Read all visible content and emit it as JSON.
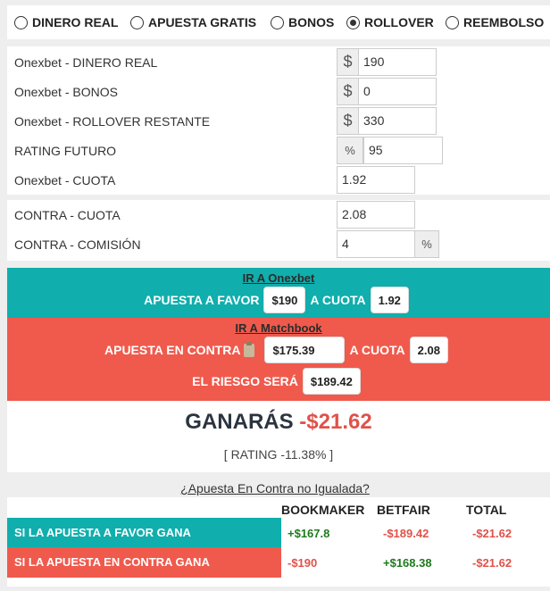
{
  "modes": [
    {
      "label": "DINERO REAL",
      "checked": false
    },
    {
      "label": "APUESTA GRATIS",
      "checked": false
    },
    {
      "label": "BONOS",
      "checked": false
    },
    {
      "label": "ROLLOVER",
      "checked": true
    },
    {
      "label": "REEMBOLSO",
      "checked": false
    }
  ],
  "bookmaker_fields": [
    {
      "label": "Onexbet - DINERO REAL",
      "addon": "$",
      "value": "190"
    },
    {
      "label": "Onexbet - BONOS",
      "addon": "$",
      "value": "0"
    },
    {
      "label": "Onexbet - ROLLOVER RESTANTE",
      "addon": "$",
      "value": "330"
    },
    {
      "label": "RATING FUTURO",
      "addon": "%",
      "value": "95"
    },
    {
      "label": "Onexbet - CUOTA",
      "addon": "",
      "value": "1.92"
    }
  ],
  "contra_fields": [
    {
      "label": "CONTRA - CUOTA",
      "value": "2.08"
    },
    {
      "label": "CONTRA - COMISIÓN",
      "value": "4",
      "addon": "%"
    }
  ],
  "favor_band": {
    "link": "IR A Onexbet",
    "stake_label": "APUESTA A FAVOR",
    "stake": "$190",
    "odds_label": "A CUOTA",
    "odds": "1.92",
    "color": "#10aeac"
  },
  "contra_band": {
    "link": "IR A Matchbook",
    "stake_label": "APUESTA EN CONTRA",
    "stake": "$175.39",
    "odds_label": "A CUOTA",
    "odds": "2.08",
    "risk_label": "EL RIESGO SERÁ",
    "risk": "$189.42",
    "color": "#ef5a4d"
  },
  "result": {
    "label": "GANARÁS",
    "value": "-$21.62",
    "rating": "[ RATING -11.38% ]"
  },
  "unmatched_link": "¿Apuesta En Contra no Igualada?",
  "table": {
    "headers": [
      "BOOKMAKER",
      "BETFAIR",
      "TOTAL"
    ],
    "rows": [
      {
        "label": "SI LA APUESTA A FAVOR GANA",
        "color": "#10aeac",
        "values": [
          "+$167.8",
          "-$189.42",
          "-$21.62"
        ]
      },
      {
        "label": "SI LA APUESTA EN CONTRA GANA",
        "color": "#ef5a4d",
        "values": [
          "-$190",
          "+$168.38",
          "-$21.62"
        ]
      }
    ]
  }
}
